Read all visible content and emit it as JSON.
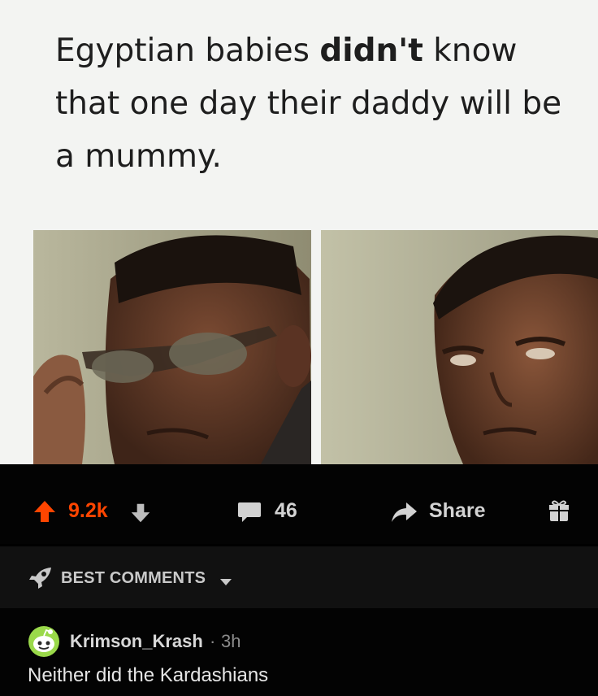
{
  "meme": {
    "caption_part1": "Egyptian babies ",
    "caption_bold": "didn't",
    "caption_part2": " know that one day their daddy will be a mummy."
  },
  "post_actions": {
    "upvote_icon": "arrow-up-icon",
    "score": "9.2k",
    "downvote_icon": "arrow-down-icon",
    "comment_icon": "speech-bubble-icon",
    "comment_count": "46",
    "share_icon": "share-arrow-icon",
    "share_label": "Share",
    "award_icon": "gift-icon",
    "score_color": "#ff4500"
  },
  "sort": {
    "icon": "rocket-icon",
    "label": "BEST COMMENTS",
    "dropdown_icon": "caret-down-icon"
  },
  "comments": [
    {
      "avatar_icon": "snoo-avatar-icon",
      "username": "Krimson_Krash",
      "separator": "·",
      "time": "3h",
      "text": "Neither did the Kardashians"
    }
  ]
}
